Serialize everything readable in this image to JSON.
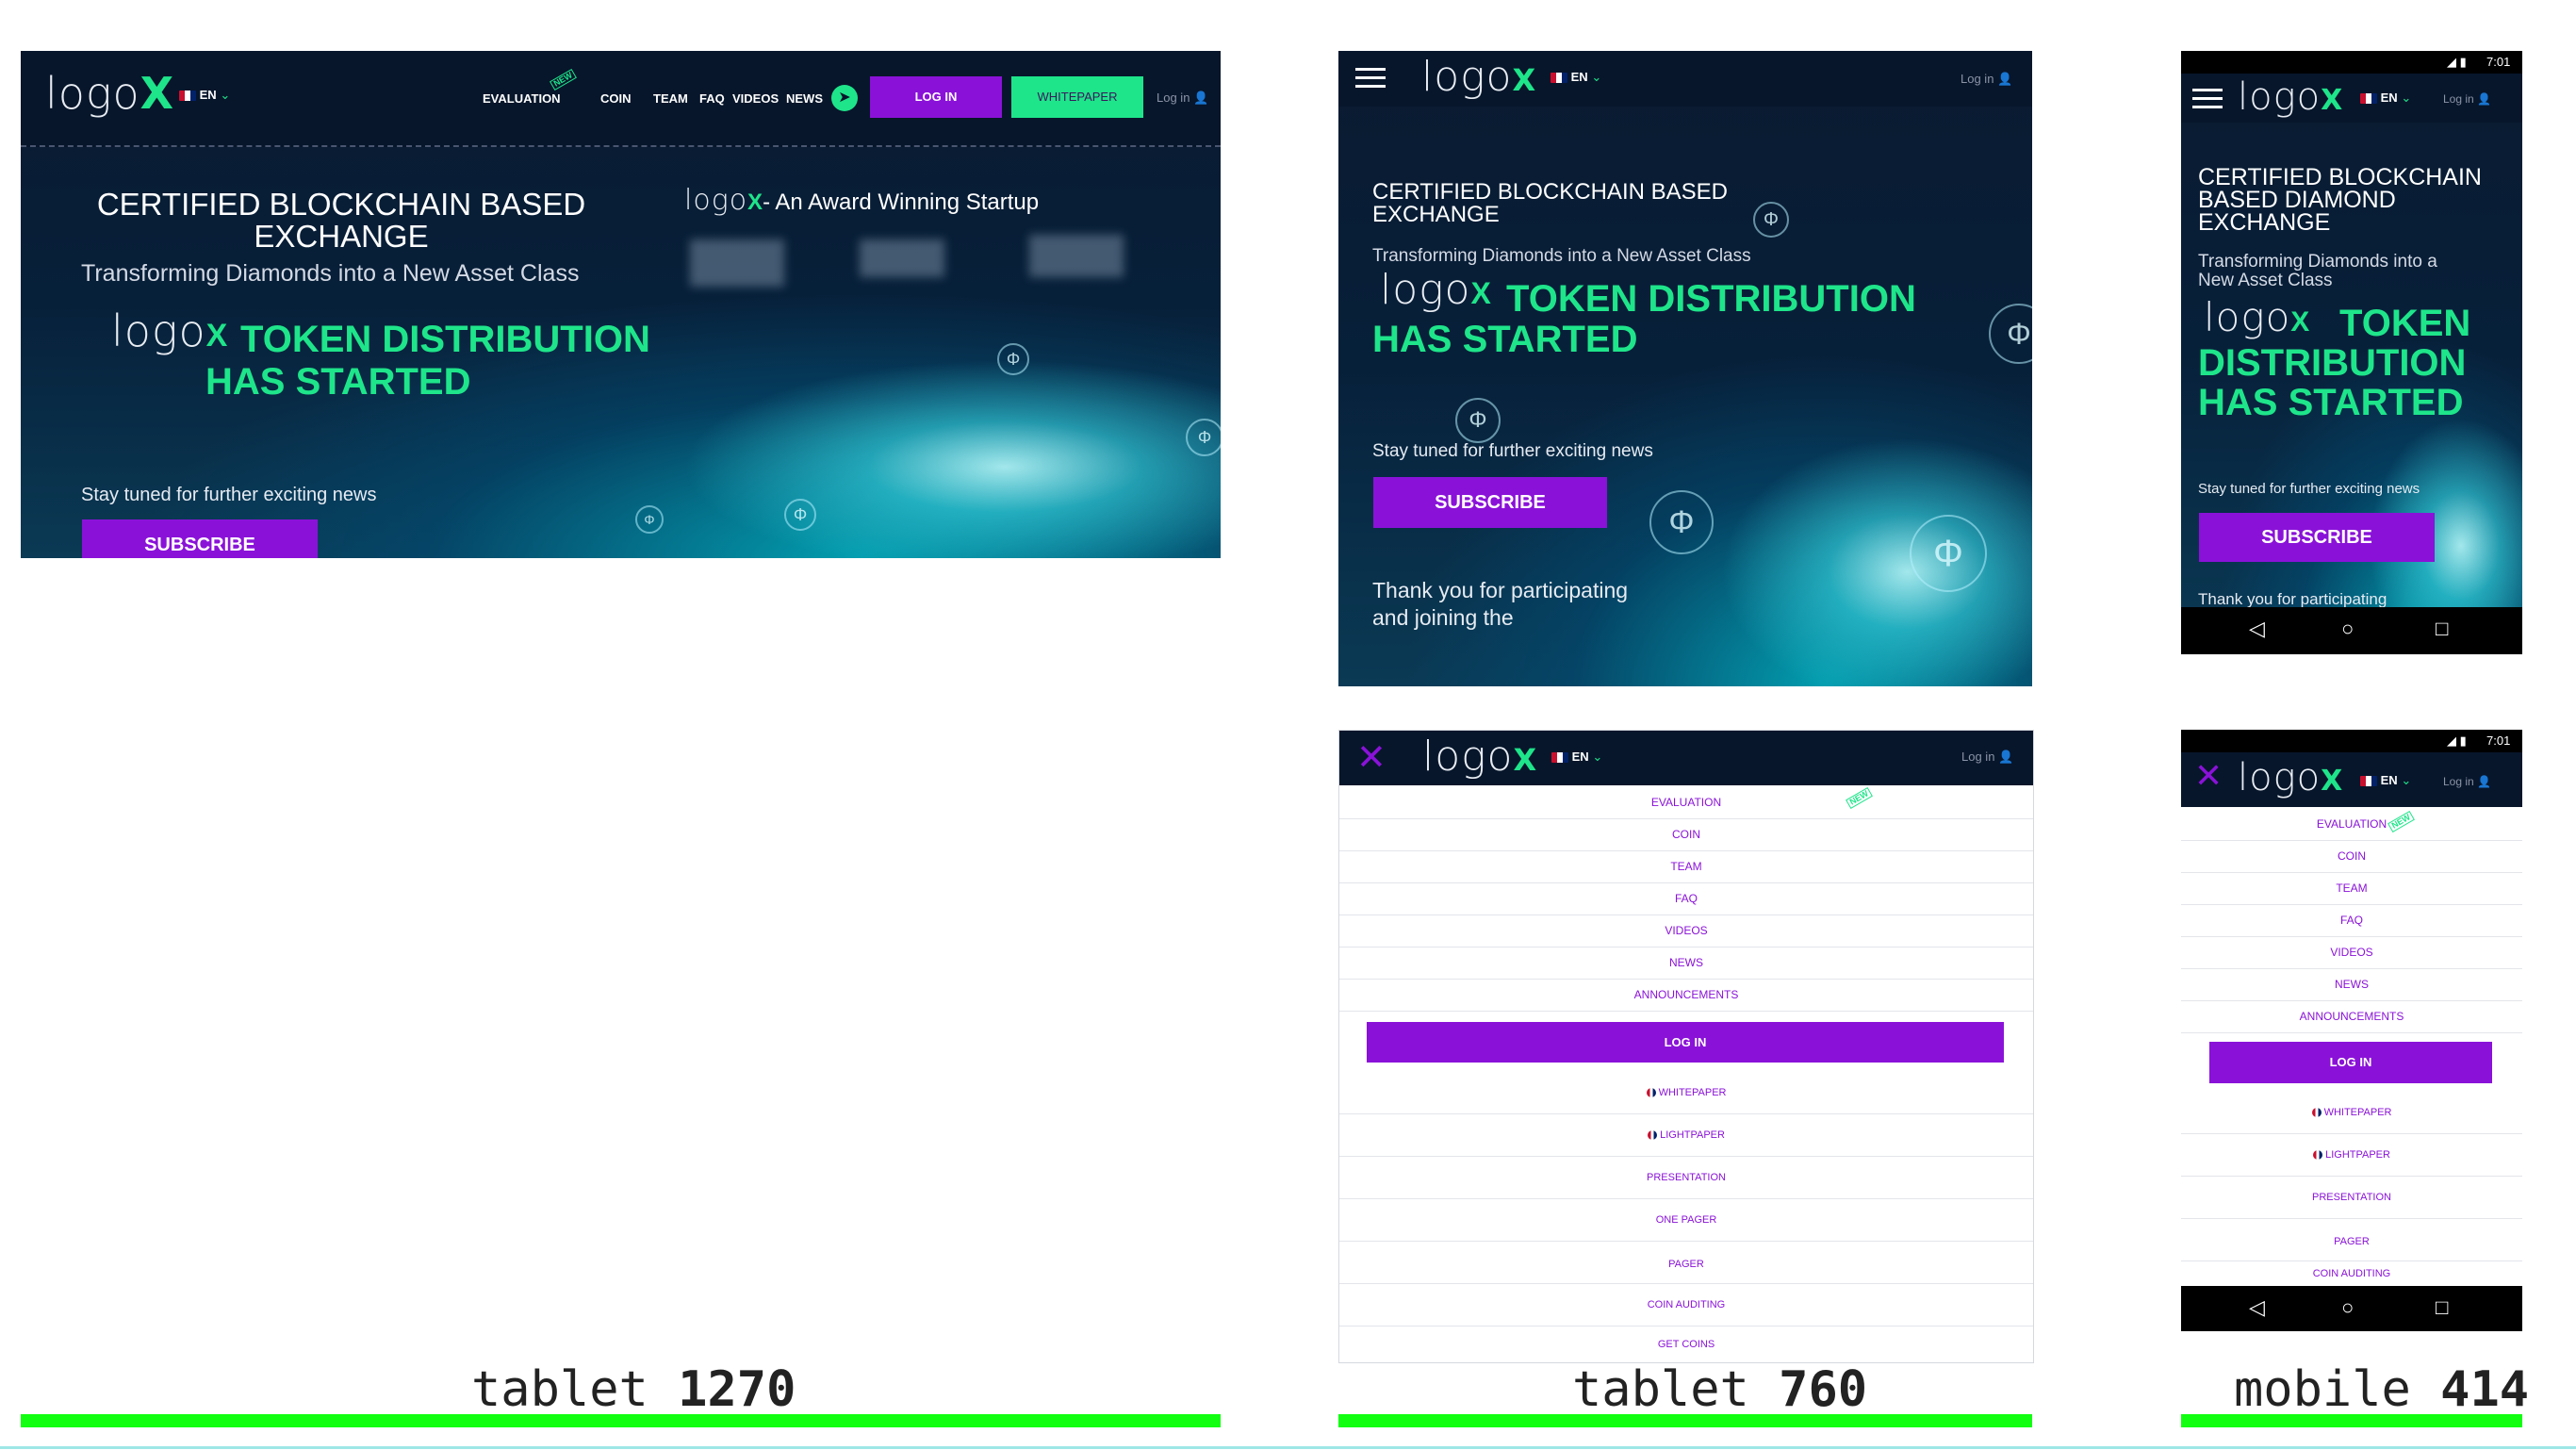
{
  "brand": {
    "logo": "logo",
    "logo_mark": "X",
    "award": "- An Award Winning Startup"
  },
  "lang": {
    "code": "EN"
  },
  "nav": {
    "login_link": "Log in",
    "links": [
      "EVALUATION",
      "COIN",
      "TEAM",
      "FAQ",
      "VIDEOS",
      "NEWS"
    ],
    "new_badge": "NEW",
    "login_button": "LOG IN",
    "whitepaper_button": "WHITEPAPER"
  },
  "hero": {
    "headline": "CERTIFIED BLOCKCHAIN BASED EXCHANGE",
    "headline_mobile": "CERTIFIED BLOCKCHAIN BASED DIAMOND EXCHANGE",
    "subtitle": "Transforming Diamonds into a New Asset Class",
    "token_line": "TOKEN DISTRIBUTION HAS STARTED",
    "token_a": "TOKEN DISTRIBUTION",
    "token_b": "HAS STARTED",
    "stay_tuned": "Stay tuned for further exciting news",
    "subscribe": "SUBSCRIBE",
    "thanks": "Thank you for participating and joining the",
    "thanks_mobile": "Thank you for participating"
  },
  "menu": {
    "items": [
      "EVALUATION",
      "COIN",
      "TEAM",
      "FAQ",
      "VIDEOS",
      "NEWS",
      "ANNOUNCEMENTS"
    ],
    "login": "LOG IN",
    "docs_tablet": [
      "WHITEPAPER",
      "LIGHTPAPER",
      "PRESENTATION",
      "ONE PAGER",
      "PAGER",
      "COIN AUDITING",
      "GET COINS"
    ],
    "docs_mobile": [
      "WHITEPAPER",
      "LIGHTPAPER",
      "PRESENTATION",
      "PAGER",
      "COIN AUDITING"
    ]
  },
  "status_bar": {
    "time": "7:01"
  },
  "captions": {
    "c1_prefix": "tablet",
    "c1_num": "1270",
    "c2_prefix": "tablet",
    "c2_num": "760",
    "c3_prefix": "mobile",
    "c3_num": "414"
  },
  "colors": {
    "accent_purple": "#8a12d8",
    "accent_green": "#1ee58a",
    "nav_bg": "#07162b",
    "device_bar": "#12ff12"
  }
}
